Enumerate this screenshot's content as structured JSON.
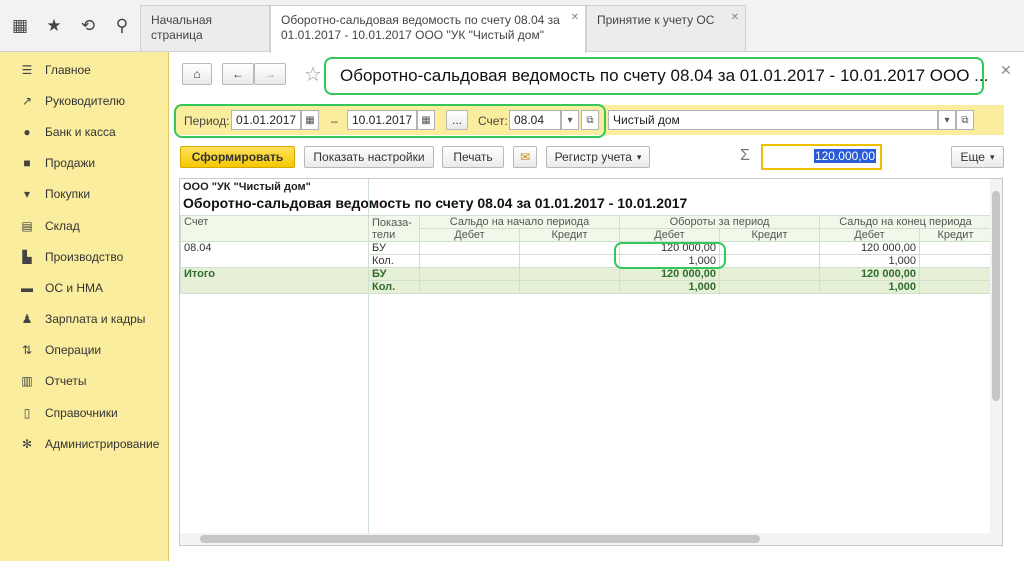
{
  "tabs": [
    {
      "label": "Начальная страница"
    },
    {
      "label": "Оборотно-сальдовая ведомость по счету 08.04 за 01.01.2017 - 10.01.2017 ООО \"УК \"Чистый дом\""
    },
    {
      "label": "Принятие к учету ОС"
    }
  ],
  "sidebar": {
    "items": [
      {
        "label": "Главное",
        "icon": "menu-icon"
      },
      {
        "label": "Руководителю",
        "icon": "trend-icon"
      },
      {
        "label": "Банк и касса",
        "icon": "coin-icon"
      },
      {
        "label": "Продажи",
        "icon": "bag-icon"
      },
      {
        "label": "Покупки",
        "icon": "cart-icon"
      },
      {
        "label": "Склад",
        "icon": "warehouse-icon"
      },
      {
        "label": "Производство",
        "icon": "factory-icon"
      },
      {
        "label": "ОС и НМА",
        "icon": "truck-icon"
      },
      {
        "label": "Зарплата и кадры",
        "icon": "person-icon"
      },
      {
        "label": "Операции",
        "icon": "operations-icon"
      },
      {
        "label": "Отчеты",
        "icon": "chart-icon"
      },
      {
        "label": "Справочники",
        "icon": "book-icon"
      },
      {
        "label": "Администрирование",
        "icon": "gear-icon"
      }
    ]
  },
  "header": {
    "title": "Оборотно-сальдовая ведомость по счету 08.04 за 01.01.2017 - 10.01.2017 ООО ..."
  },
  "filters": {
    "period_label": "Период:",
    "date_from": "01.01.2017",
    "dash": "–",
    "date_to": "10.01.2017",
    "dots": "...",
    "account_label": "Счет:",
    "account": "08.04",
    "org": "Чистый дом"
  },
  "toolbar": {
    "generate": "Сформировать",
    "settings": "Показать настройки",
    "print": "Печать",
    "register": "Регистр учета",
    "sum_value": "120.000,00",
    "more": "Еще"
  },
  "report": {
    "org": "ООО \"УК \"Чистый дом\"",
    "title": "Оборотно-сальдовая ведомость по счету 08.04 за 01.01.2017 - 10.01.2017",
    "h_account": "Счет",
    "h_indicators": "Показа-\nтели",
    "h_start": "Сальдо на начало периода",
    "h_turnover": "Обороты за период",
    "h_end": "Сальдо на конец периода",
    "debit": "Дебет",
    "credit": "Кредит",
    "row_account": "08.04",
    "bu": "БУ",
    "kol": "Кол.",
    "row_turn_debit_bu": "120 000,00",
    "row_turn_debit_kol": "1,000",
    "row_end_debit_bu": "120 000,00",
    "row_end_debit_kol": "1,000",
    "total": "Итого",
    "tot_turn_debit_bu": "120 000,00",
    "tot_turn_debit_kol": "1,000",
    "tot_end_debit_bu": "120 000,00",
    "tot_end_debit_kol": "1,000"
  }
}
